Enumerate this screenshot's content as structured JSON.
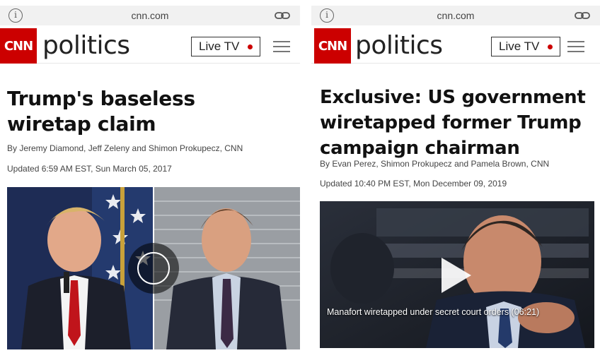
{
  "left": {
    "url": "cnn.com",
    "logo": "CNN",
    "section": "politics",
    "live_tv": "Live TV",
    "headline": "Trump's baseless wiretap claim",
    "byline": "By Jeremy Diamond, Jeff Zeleny and Shimon Prokupecz, CNN",
    "updated": "Updated 6:59 AM EST, Sun March 05, 2017"
  },
  "right": {
    "url": "cnn.com",
    "logo": "CNN",
    "section": "politics",
    "live_tv": "Live TV",
    "headline": "Exclusive: US government wiretapped former Trump campaign chairman",
    "byline": "By Evan Perez, Shimon Prokupecz and Pamela Brown, CNN",
    "updated": "Updated 10:40 PM EST, Mon December 09, 2019",
    "video_caption": "Manafort wiretapped under secret court orders (06:21)"
  },
  "colors": {
    "brand": "#cc0000",
    "live_dot": "#cc0000"
  },
  "icons": [
    "info-icon",
    "link-icon",
    "hamburger-menu-icon",
    "play-icon"
  ]
}
